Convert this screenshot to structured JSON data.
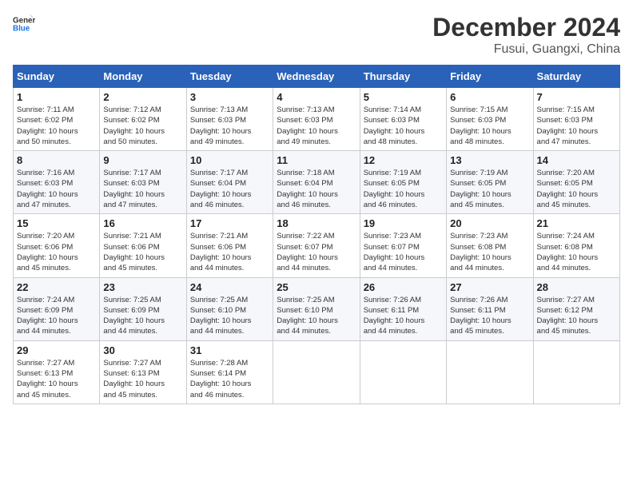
{
  "header": {
    "logo_line1": "General",
    "logo_line2": "Blue",
    "month": "December 2024",
    "location": "Fusui, Guangxi, China"
  },
  "weekdays": [
    "Sunday",
    "Monday",
    "Tuesday",
    "Wednesday",
    "Thursday",
    "Friday",
    "Saturday"
  ],
  "weeks": [
    [
      {
        "day": "1",
        "detail": "Sunrise: 7:11 AM\nSunset: 6:02 PM\nDaylight: 10 hours\nand 50 minutes."
      },
      {
        "day": "2",
        "detail": "Sunrise: 7:12 AM\nSunset: 6:02 PM\nDaylight: 10 hours\nand 50 minutes."
      },
      {
        "day": "3",
        "detail": "Sunrise: 7:13 AM\nSunset: 6:03 PM\nDaylight: 10 hours\nand 49 minutes."
      },
      {
        "day": "4",
        "detail": "Sunrise: 7:13 AM\nSunset: 6:03 PM\nDaylight: 10 hours\nand 49 minutes."
      },
      {
        "day": "5",
        "detail": "Sunrise: 7:14 AM\nSunset: 6:03 PM\nDaylight: 10 hours\nand 48 minutes."
      },
      {
        "day": "6",
        "detail": "Sunrise: 7:15 AM\nSunset: 6:03 PM\nDaylight: 10 hours\nand 48 minutes."
      },
      {
        "day": "7",
        "detail": "Sunrise: 7:15 AM\nSunset: 6:03 PM\nDaylight: 10 hours\nand 47 minutes."
      }
    ],
    [
      {
        "day": "8",
        "detail": "Sunrise: 7:16 AM\nSunset: 6:03 PM\nDaylight: 10 hours\nand 47 minutes."
      },
      {
        "day": "9",
        "detail": "Sunrise: 7:17 AM\nSunset: 6:03 PM\nDaylight: 10 hours\nand 47 minutes."
      },
      {
        "day": "10",
        "detail": "Sunrise: 7:17 AM\nSunset: 6:04 PM\nDaylight: 10 hours\nand 46 minutes."
      },
      {
        "day": "11",
        "detail": "Sunrise: 7:18 AM\nSunset: 6:04 PM\nDaylight: 10 hours\nand 46 minutes."
      },
      {
        "day": "12",
        "detail": "Sunrise: 7:19 AM\nSunset: 6:05 PM\nDaylight: 10 hours\nand 46 minutes."
      },
      {
        "day": "13",
        "detail": "Sunrise: 7:19 AM\nSunset: 6:05 PM\nDaylight: 10 hours\nand 45 minutes."
      },
      {
        "day": "14",
        "detail": "Sunrise: 7:20 AM\nSunset: 6:05 PM\nDaylight: 10 hours\nand 45 minutes."
      }
    ],
    [
      {
        "day": "15",
        "detail": "Sunrise: 7:20 AM\nSunset: 6:06 PM\nDaylight: 10 hours\nand 45 minutes."
      },
      {
        "day": "16",
        "detail": "Sunrise: 7:21 AM\nSunset: 6:06 PM\nDaylight: 10 hours\nand 45 minutes."
      },
      {
        "day": "17",
        "detail": "Sunrise: 7:21 AM\nSunset: 6:06 PM\nDaylight: 10 hours\nand 44 minutes."
      },
      {
        "day": "18",
        "detail": "Sunrise: 7:22 AM\nSunset: 6:07 PM\nDaylight: 10 hours\nand 44 minutes."
      },
      {
        "day": "19",
        "detail": "Sunrise: 7:23 AM\nSunset: 6:07 PM\nDaylight: 10 hours\nand 44 minutes."
      },
      {
        "day": "20",
        "detail": "Sunrise: 7:23 AM\nSunset: 6:08 PM\nDaylight: 10 hours\nand 44 minutes."
      },
      {
        "day": "21",
        "detail": "Sunrise: 7:24 AM\nSunset: 6:08 PM\nDaylight: 10 hours\nand 44 minutes."
      }
    ],
    [
      {
        "day": "22",
        "detail": "Sunrise: 7:24 AM\nSunset: 6:09 PM\nDaylight: 10 hours\nand 44 minutes."
      },
      {
        "day": "23",
        "detail": "Sunrise: 7:25 AM\nSunset: 6:09 PM\nDaylight: 10 hours\nand 44 minutes."
      },
      {
        "day": "24",
        "detail": "Sunrise: 7:25 AM\nSunset: 6:10 PM\nDaylight: 10 hours\nand 44 minutes."
      },
      {
        "day": "25",
        "detail": "Sunrise: 7:25 AM\nSunset: 6:10 PM\nDaylight: 10 hours\nand 44 minutes."
      },
      {
        "day": "26",
        "detail": "Sunrise: 7:26 AM\nSunset: 6:11 PM\nDaylight: 10 hours\nand 44 minutes."
      },
      {
        "day": "27",
        "detail": "Sunrise: 7:26 AM\nSunset: 6:11 PM\nDaylight: 10 hours\nand 45 minutes."
      },
      {
        "day": "28",
        "detail": "Sunrise: 7:27 AM\nSunset: 6:12 PM\nDaylight: 10 hours\nand 45 minutes."
      }
    ],
    [
      {
        "day": "29",
        "detail": "Sunrise: 7:27 AM\nSunset: 6:13 PM\nDaylight: 10 hours\nand 45 minutes."
      },
      {
        "day": "30",
        "detail": "Sunrise: 7:27 AM\nSunset: 6:13 PM\nDaylight: 10 hours\nand 45 minutes."
      },
      {
        "day": "31",
        "detail": "Sunrise: 7:28 AM\nSunset: 6:14 PM\nDaylight: 10 hours\nand 46 minutes."
      },
      null,
      null,
      null,
      null
    ]
  ]
}
